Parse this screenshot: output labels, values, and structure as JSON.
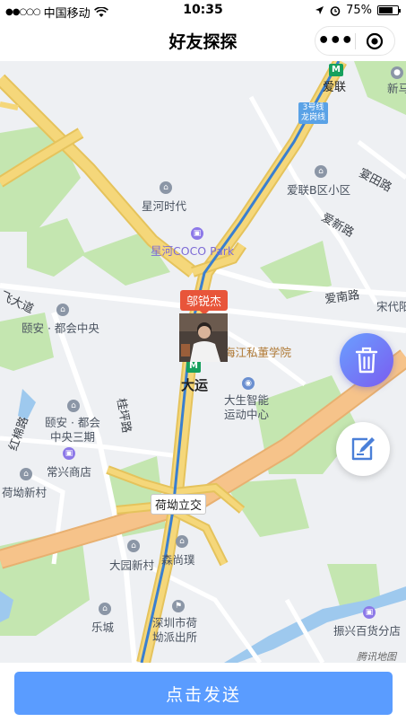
{
  "status_bar": {
    "signal": "●●○○○",
    "carrier": "中国移动",
    "time": "10:35",
    "battery_percent": "75%",
    "battery_level": 0.75
  },
  "nav": {
    "title": "好友探探",
    "more_icon": "ellipsis-icon",
    "close_icon": "target-close-icon"
  },
  "map": {
    "labels": {
      "ailian": "爱联",
      "xindai": "新马",
      "metro_line": "3号线\n龙岗线",
      "ailian_b": "爱联B区小区",
      "yanting_road": "宴田路",
      "xinghe_shidai": "星河时代",
      "aixin_road": "爱新路",
      "xinghe_coco": "星河COCO Park",
      "ainan_road": "爱南路",
      "songdai": "宋代阳",
      "fei_dadao": "飞大道",
      "yian_duhui": "颐安 · 都会中央",
      "haijiang_school": "海江私董学院",
      "dayun": "大运",
      "dasheng": "大生智能\n运动中心",
      "guiping_road": "桂坪路",
      "yian_duhui_3": "颐安 · 都会\n中央三期",
      "hongmian_road": "红棉路",
      "changxing": "常兴商店",
      "hetang_xincun": "荷坳新村",
      "hetang_interchange": "荷坳立交",
      "dayuan_xincun": "大园新村",
      "senshangpu": "森尚璞",
      "lecheng": "乐城",
      "police": "深圳市荷\n坳派出所",
      "zhenxing": "振兴百货分店",
      "tencent": "腾讯地图"
    },
    "friend_name": "邬锐杰",
    "trash_icon": "trash-icon",
    "edit_icon": "edit-icon",
    "colors": {
      "road_major": "#f5d77a",
      "road_orange": "#f6c38a",
      "green": "#c4e6b0",
      "water": "#9ec9ee",
      "metro_line": "#3a7fd0"
    }
  },
  "bottom": {
    "send_label": "点击发送"
  }
}
